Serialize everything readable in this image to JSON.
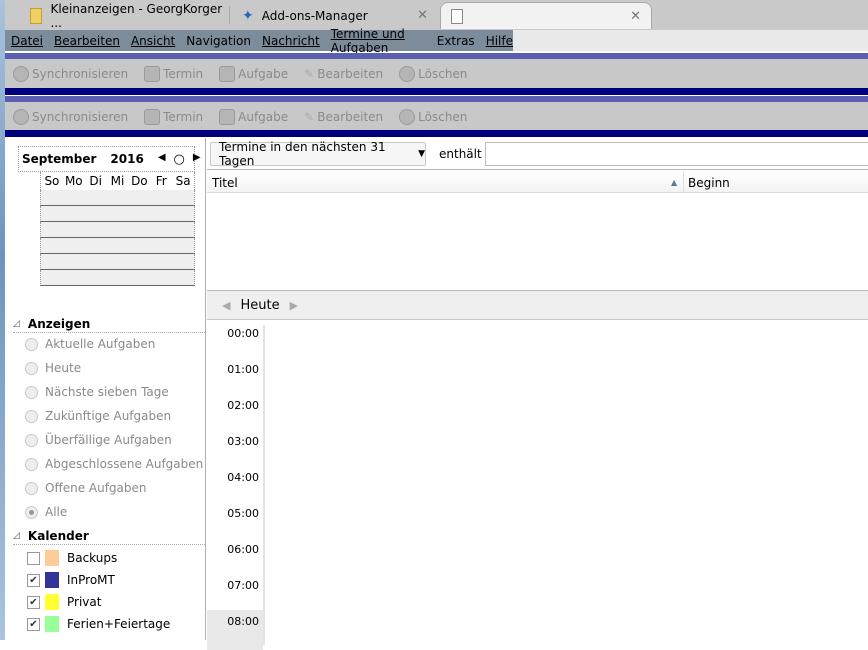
{
  "tabs": [
    {
      "label": "Kleinanzeigen - GeorgKorger ...",
      "icon": "folder-icon"
    },
    {
      "label": "Add-ons-Manager",
      "icon": "puzzle-icon"
    },
    {
      "label": "",
      "icon": "page-icon"
    }
  ],
  "menu": [
    "Datei",
    "Bearbeiten",
    "Ansicht",
    "Navigation",
    "Nachricht",
    "Termine und Aufgaben",
    "Extras",
    "Hilfe"
  ],
  "toolbar": [
    "Synchronisieren",
    "Termin",
    "Aufgabe",
    "Bearbeiten",
    "Löschen"
  ],
  "minical": {
    "month": "September",
    "year": "2016",
    "days": [
      "So",
      "Mo",
      "Di",
      "Mi",
      "Do",
      "Fr",
      "Sa"
    ]
  },
  "anzeigen": {
    "title": "Anzeigen",
    "items": [
      "Aktuelle Aufgaben",
      "Heute",
      "Nächste sieben Tage",
      "Zukünftige Aufgaben",
      "Überfällige Aufgaben",
      "Abgeschlossene Aufgaben",
      "Offene Aufgaben",
      "Alle"
    ],
    "selected": "Alle"
  },
  "kalender": {
    "title": "Kalender",
    "items": [
      {
        "name": "Backups",
        "checked": false,
        "color": "#ffcc99"
      },
      {
        "name": "InProMT",
        "checked": true,
        "color": "#333399"
      },
      {
        "name": "Privat",
        "checked": true,
        "color": "#ffff33"
      },
      {
        "name": "Ferien+Feiertage",
        "checked": true,
        "color": "#99ff99"
      }
    ]
  },
  "filter": {
    "range": "Termine in den nächsten 31 Tagen",
    "contains": "enthält",
    "search": ""
  },
  "columns": {
    "title": "Titel",
    "begin": "Beginn"
  },
  "nav": {
    "today": "Heute"
  },
  "hours": [
    "00:00",
    "01:00",
    "02:00",
    "03:00",
    "04:00",
    "05:00",
    "06:00",
    "07:00",
    "08:00"
  ]
}
